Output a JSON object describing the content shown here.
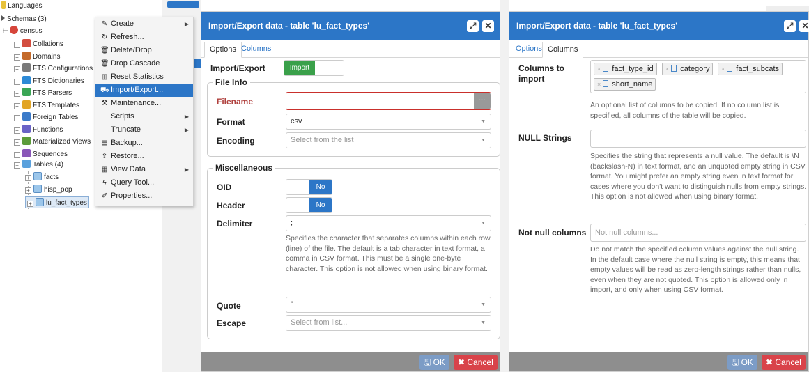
{
  "tree": {
    "top_label": "Languages",
    "schemas": "Schemas (3)",
    "census": "census",
    "items": [
      {
        "label": "Collations",
        "icon": "collation-icon",
        "color": "#d34d3f"
      },
      {
        "label": "Domains",
        "icon": "domain-icon",
        "color": "#c46a2a"
      },
      {
        "label": "FTS Configurations",
        "icon": "fts-config-icon",
        "color": "#7a7a7a"
      },
      {
        "label": "FTS Dictionaries",
        "icon": "fts-dictionary-icon",
        "color": "#2d8ad6"
      },
      {
        "label": "FTS Parsers",
        "icon": "fts-parser-icon",
        "color": "#3aa655"
      },
      {
        "label": "FTS Templates",
        "icon": "fts-template-icon",
        "color": "#e2a526"
      },
      {
        "label": "Foreign Tables",
        "icon": "foreign-table-icon",
        "color": "#3a7ac9"
      },
      {
        "label": "Functions",
        "icon": "function-icon",
        "color": "#6a63c7"
      },
      {
        "label": "Materialized Views",
        "icon": "matview-icon",
        "color": "#5c9c3a"
      },
      {
        "label": "Sequences",
        "icon": "sequence-icon",
        "color": "#8a57b8"
      }
    ],
    "tables": "Tables (4)",
    "tables_children": [
      "facts",
      "hisp_pop",
      "lu_fact_types"
    ]
  },
  "context_menu": [
    {
      "label": "Create",
      "icon": "create-icon",
      "glyph": "✎",
      "submenu": true
    },
    {
      "label": "Refresh...",
      "icon": "refresh-icon",
      "glyph": "↻",
      "submenu": false
    },
    {
      "label": "Delete/Drop",
      "icon": "delete-icon",
      "glyph": "🗑",
      "submenu": false
    },
    {
      "label": "Drop Cascade",
      "icon": "drop-cascade-icon",
      "glyph": "🗑",
      "submenu": false
    },
    {
      "label": "Reset Statistics",
      "icon": "statistics-icon",
      "glyph": "▥",
      "submenu": false
    },
    {
      "label": "Import/Export...",
      "icon": "cart-icon",
      "glyph": "⛟",
      "submenu": false,
      "active": true
    },
    {
      "label": "Maintenance...",
      "icon": "wrench-icon",
      "glyph": "⚒",
      "submenu": false
    },
    {
      "label": "Scripts",
      "icon": "",
      "glyph": "",
      "submenu": true
    },
    {
      "label": "Truncate",
      "icon": "",
      "glyph": "",
      "submenu": true
    },
    {
      "label": "Backup...",
      "icon": "backup-icon",
      "glyph": "▤",
      "submenu": false
    },
    {
      "label": "Restore...",
      "icon": "restore-icon",
      "glyph": "⇪",
      "submenu": false
    },
    {
      "label": "View Data",
      "icon": "view-data-icon",
      "glyph": "▦",
      "submenu": true
    },
    {
      "label": "Query Tool...",
      "icon": "query-tool-icon",
      "glyph": "ϟ",
      "submenu": false
    },
    {
      "label": "Properties...",
      "icon": "properties-icon",
      "glyph": "✐",
      "submenu": false
    }
  ],
  "dialog_left": {
    "title": "Import/Export data - table 'lu_fact_types'",
    "tabs": [
      "Options",
      "Columns"
    ],
    "import_export_label": "Import/Export",
    "import_toggle": "Import",
    "file_info_legend": "File Info",
    "filename_label": "Filename",
    "filename_value": "",
    "browse_glyph": "···",
    "format_label": "Format",
    "format_value": "csv",
    "encoding_label": "Encoding",
    "encoding_placeholder": "Select from the list",
    "misc_legend": "Miscellaneous",
    "oid_label": "OID",
    "oid_value": "No",
    "header_label": "Header",
    "header_value": "No",
    "delimiter_label": "Delimiter",
    "delimiter_value": ";",
    "delimiter_help": "Specifies the character that separates columns within each row (line) of the file. The default is a tab character in text format, a comma in CSV format. This must be a single one-byte character. This option is not allowed when using binary format.",
    "quote_label": "Quote",
    "quote_value": "\"",
    "escape_label": "Escape",
    "escape_placeholder": "Select from list...",
    "ok_label": "OK",
    "cancel_label": "Cancel"
  },
  "dialog_right": {
    "title": "Import/Export data - table 'lu_fact_types'",
    "tabs": [
      "Options",
      "Columns"
    ],
    "columns_label": "Columns to import",
    "columns": [
      "fact_type_id",
      "category",
      "fact_subcats",
      "short_name"
    ],
    "columns_help": "An optional list of columns to be copied. If no column list is specified, all columns of the table will be copied.",
    "null_strings_label": "NULL Strings",
    "null_strings_help": "Specifies the string that represents a null value. The default is \\N (backslash-N) in text format, and an unquoted empty string in CSV format. You might prefer an empty string even in text format for cases where you don't want to distinguish nulls from empty strings. This option is not allowed when using binary format.",
    "not_null_label": "Not null columns",
    "not_null_placeholder": "Not null columns...",
    "not_null_help": "Do not match the specified column values against the null string. In the default case where the null string is empty, this means that empty values will be read as zero-length strings rather than nulls, even when they are not quoted. This option is allowed only in import, and only when using CSV format.",
    "ok_label": "OK",
    "cancel_label": "Cancel"
  },
  "colors": {
    "accent": "#2c76c7",
    "toggle_import": "#3aa04a",
    "toggle_no": "#2c76c7",
    "cancel": "#d9434a",
    "footer": "#8e8e8e"
  }
}
